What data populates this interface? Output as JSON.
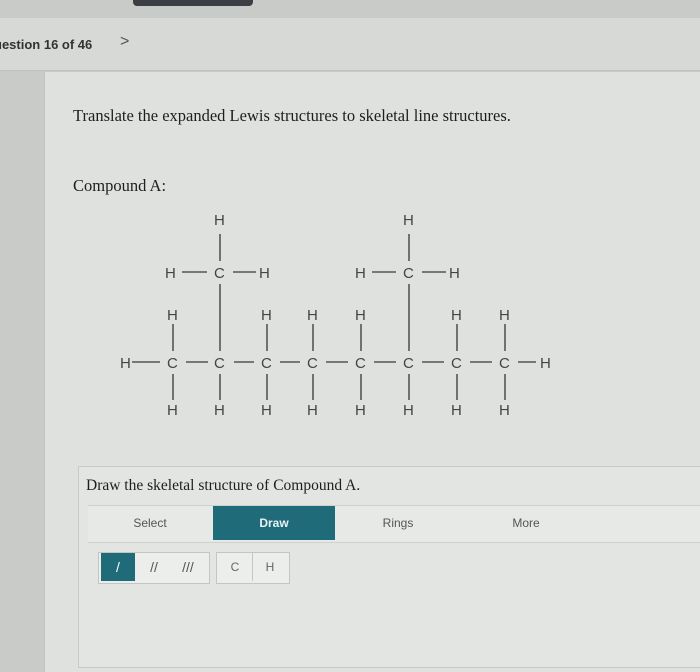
{
  "header": {
    "question_label": "uestion 16 of 46",
    "next_glyph": ">"
  },
  "question": {
    "prompt": "Translate the expanded Lewis structures to skeletal line structures.",
    "compound_label": "Compound A:",
    "atom_carbon": "C",
    "atom_hydrogen": "H"
  },
  "answer": {
    "draw_prompt": "Draw the skeletal structure of Compound A."
  },
  "toolbar": {
    "select": "Select",
    "draw": "Draw",
    "rings": "Rings",
    "more": "More"
  },
  "bonds": {
    "single": "/",
    "double": "//",
    "triple": "///"
  },
  "atoms": {
    "carbon": "C",
    "hydrogen": "H"
  },
  "colors": {
    "accent": "#1f6b7a",
    "background": "#dfe1de"
  }
}
